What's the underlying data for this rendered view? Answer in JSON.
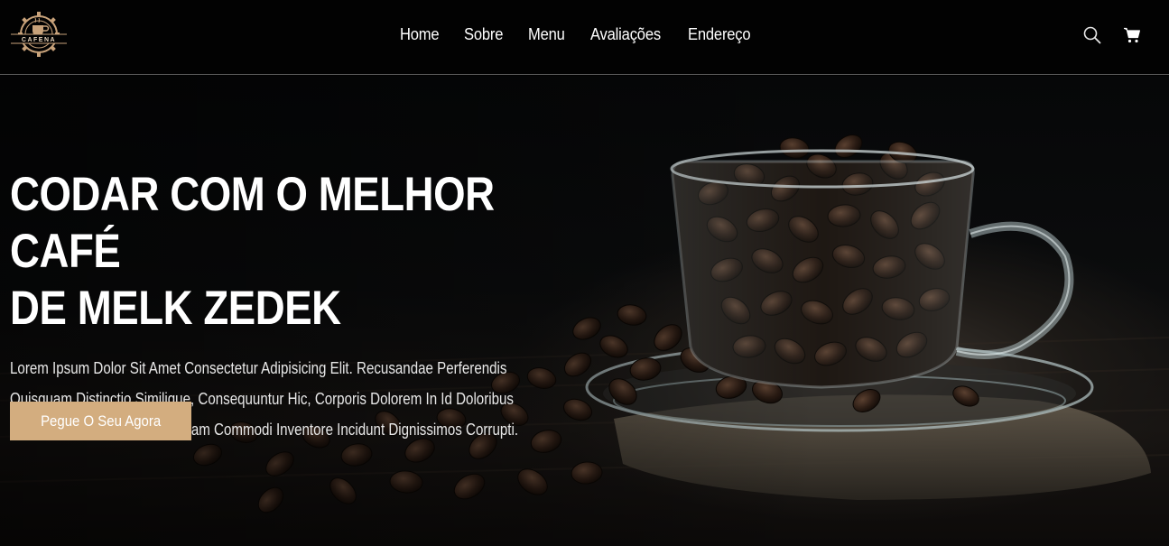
{
  "brand": {
    "logo_text": "CAFENA",
    "logo_icon": "coffee-cup-gear-icon",
    "accent": "#d3ad7f"
  },
  "nav": {
    "links": [
      "Home",
      "Sobre",
      "Menu",
      "Avaliações",
      "Endereço"
    ],
    "icons": [
      "search-icon",
      "cart-icon"
    ]
  },
  "hero": {
    "title_line1": "CODAR COM O MELHOR CAFÉ",
    "title_line2": "DE MELK ZEDEK",
    "text_line1": "Lorem Ipsum Dolor Sit Amet Consectetur Adipisicing Elit. Recusandae Perferendis",
    "text_line2": "Quisquam Distinctio Similique, Consequuntur Hic, Corporis Dolorem In Id Doloribus",
    "text_line3": "Totam Iusto, Iure Eum Numquam Commodi Inventore Incidunt Dignissimos Corrupti.",
    "button_label": "Pegue O Seu Agora",
    "background": "coffee-beans-glass-cup-image"
  }
}
